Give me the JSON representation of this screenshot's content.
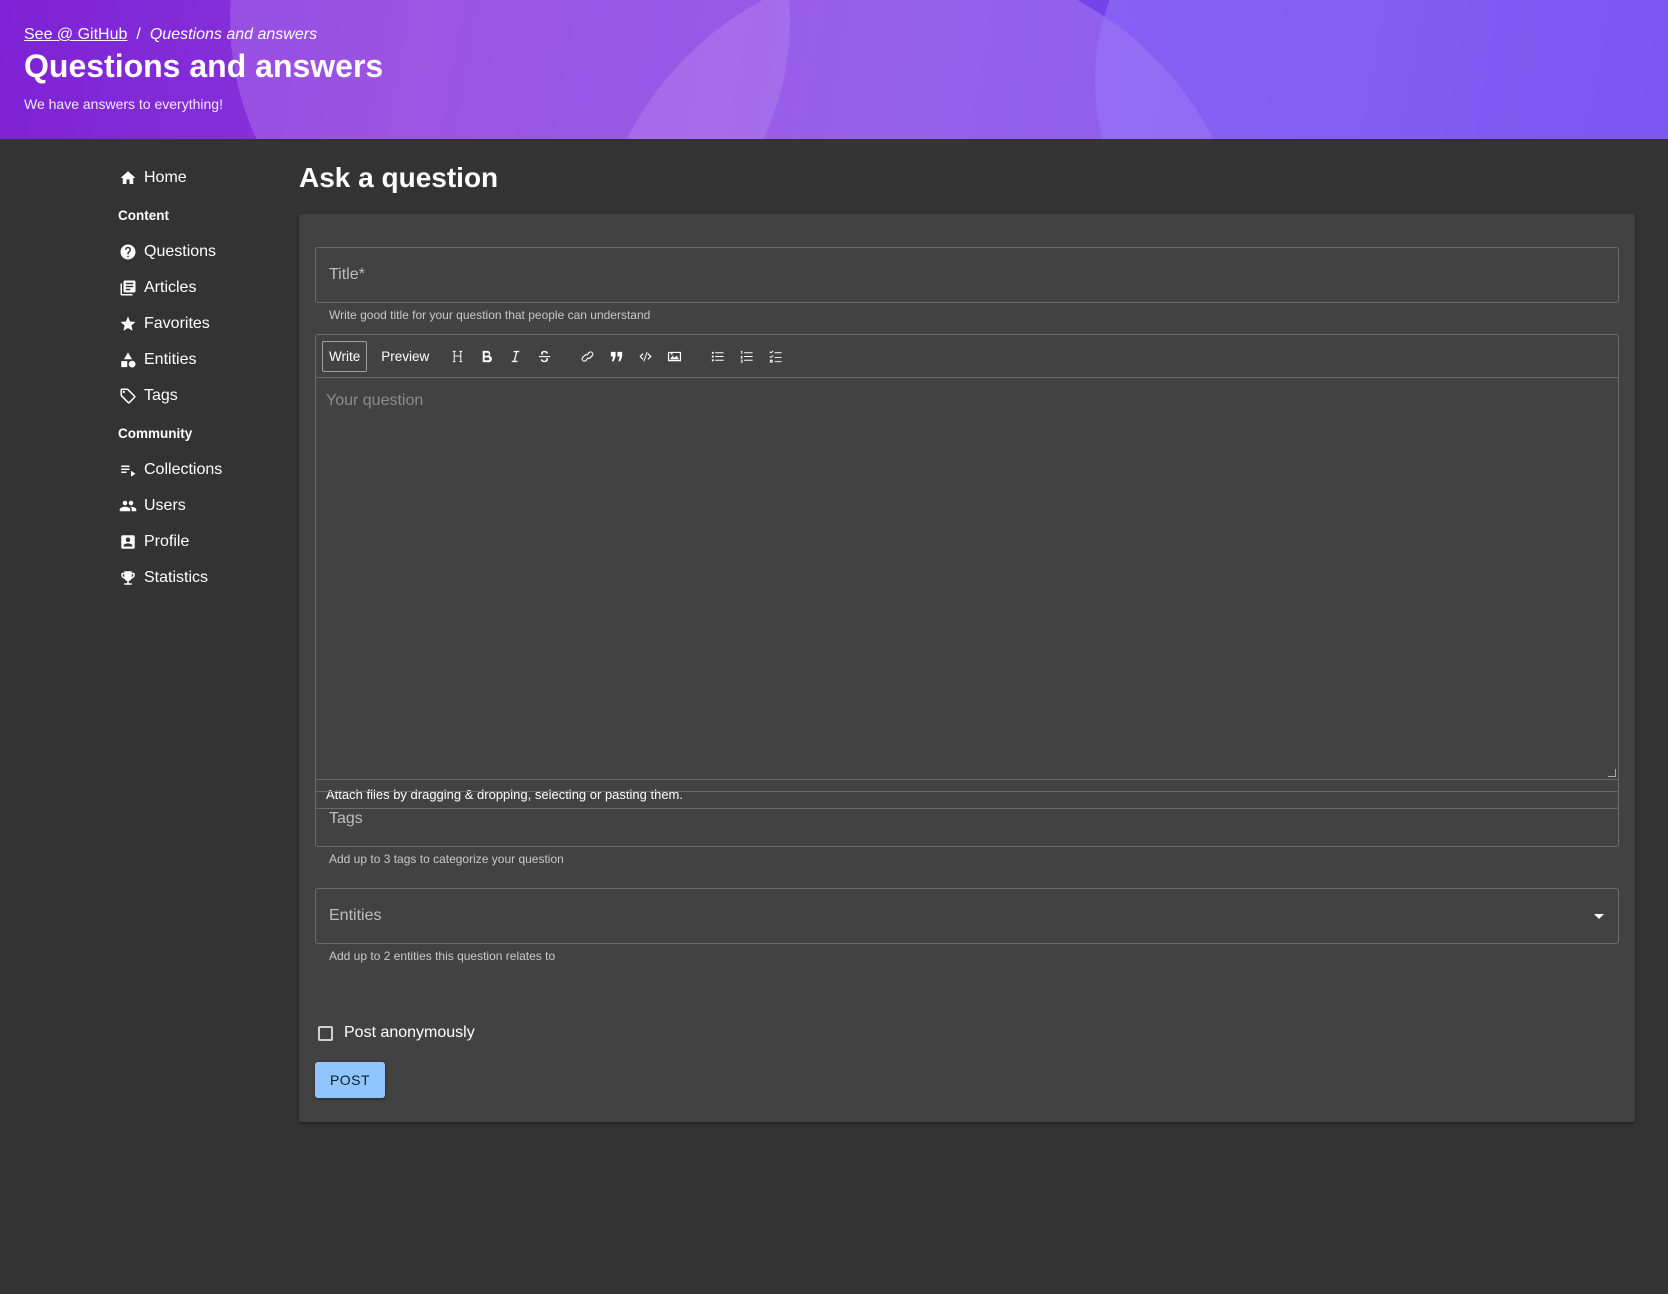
{
  "header": {
    "breadcrumb_link": "See @ GitHub",
    "breadcrumb_separator": "/",
    "breadcrumb_current": "Questions and answers",
    "title": "Questions and answers",
    "subtitle": "We have answers to everything!"
  },
  "sidebar": {
    "home": {
      "label": "Home",
      "icon": "home-icon"
    },
    "section_content": "Content",
    "content_items": [
      {
        "label": "Questions",
        "icon": "help-circle-icon"
      },
      {
        "label": "Articles",
        "icon": "library-books-icon"
      },
      {
        "label": "Favorites",
        "icon": "star-icon"
      },
      {
        "label": "Entities",
        "icon": "shapes-icon"
      },
      {
        "label": "Tags",
        "icon": "tag-icon"
      }
    ],
    "section_community": "Community",
    "community_items": [
      {
        "label": "Collections",
        "icon": "playlist-icon"
      },
      {
        "label": "Users",
        "icon": "group-icon"
      },
      {
        "label": "Profile",
        "icon": "account-box-icon"
      },
      {
        "label": "Statistics",
        "icon": "trophy-icon"
      }
    ]
  },
  "main": {
    "page_title": "Ask a question",
    "title_field": {
      "placeholder": "Title*",
      "helper": "Write good title for your question that people can understand"
    },
    "editor": {
      "tab_write": "Write",
      "tab_preview": "Preview",
      "tools": [
        "heading-icon",
        "bold-icon",
        "italic-icon",
        "strikethrough-icon",
        "link-icon",
        "quote-icon",
        "code-icon",
        "image-icon",
        "bullet-list-icon",
        "numbered-list-icon",
        "task-list-icon"
      ],
      "placeholder": "Your question",
      "attach_text": "Attach files by dragging & dropping, selecting or pasting them."
    },
    "tags_field": {
      "placeholder": "Tags",
      "helper": "Add up to 3 tags to categorize your question"
    },
    "entities_field": {
      "placeholder": "Entities",
      "helper": "Add up to 2 entities this question relates to"
    },
    "anonymous_label": "Post anonymously",
    "post_button": "POST"
  },
  "colors": {
    "background": "#333333",
    "card": "#424242",
    "accent": "#90c6ff",
    "header_gradient_start": "#7d22d6",
    "header_gradient_end": "#5b2ee8"
  }
}
